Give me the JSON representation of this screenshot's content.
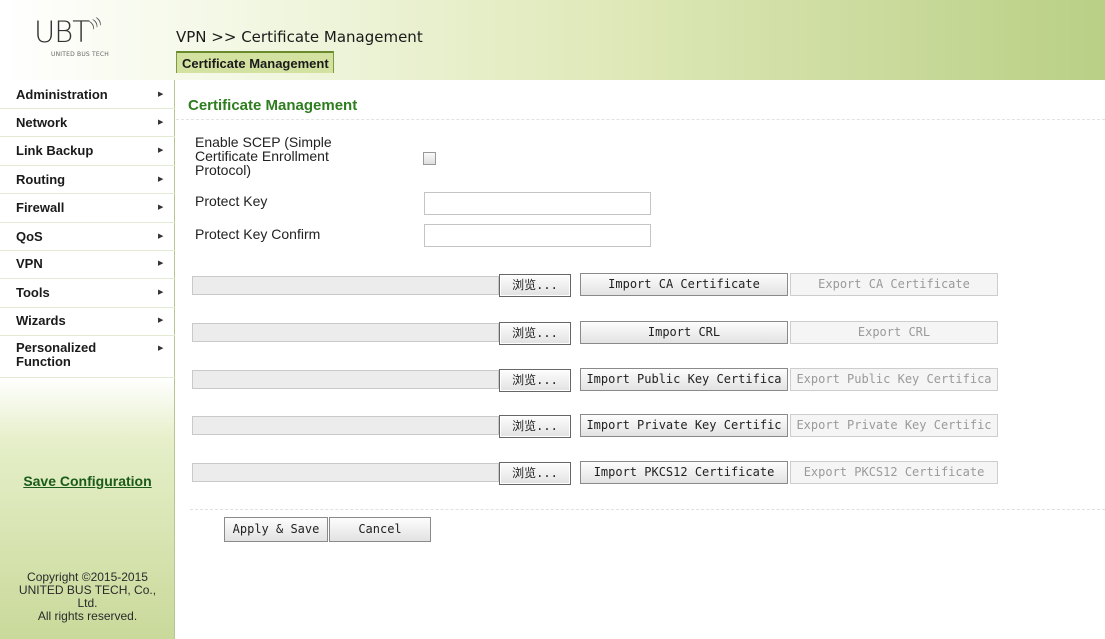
{
  "logo": {
    "mark": "UBT",
    "subtitle": "UNITED BUS TECH"
  },
  "header": {
    "breadcrumb": "VPN >> Certificate Management",
    "active_tab": "Certificate Management"
  },
  "sidebar": {
    "items": [
      {
        "label": "Administration",
        "arrow": "▶"
      },
      {
        "label": "Network",
        "arrow": "▶"
      },
      {
        "label": "Link Backup",
        "arrow": "▶"
      },
      {
        "label": "Routing",
        "arrow": "▶"
      },
      {
        "label": "Firewall",
        "arrow": "▶"
      },
      {
        "label": "QoS",
        "arrow": "▶"
      },
      {
        "label": "VPN",
        "arrow": "▶"
      },
      {
        "label": "Tools",
        "arrow": "▶"
      },
      {
        "label": "Wizards",
        "arrow": "▶"
      },
      {
        "label": "Personalized Function",
        "arrow": "▶"
      }
    ],
    "save_configuration": "Save Configuration",
    "copyright_lines": [
      "Copyright ©2015-2015",
      "UNITED BUS TECH, Co.,",
      "Ltd.",
      "All rights reserved."
    ]
  },
  "main": {
    "section_title": "Certificate Management",
    "scep_label_lines": [
      "Enable SCEP (Simple",
      "Certificate Enrollment",
      "Protocol)"
    ],
    "scep_enabled": false,
    "protect_key_label": "Protect Key",
    "protect_key_value": "",
    "protect_key_confirm_label": "Protect Key Confirm",
    "protect_key_confirm_value": "",
    "browse_label": "浏览...",
    "cert_rows": [
      {
        "import_label": "Import CA Certificate",
        "export_label": "Export CA Certificate"
      },
      {
        "import_label": "Import CRL",
        "export_label": "Export CRL"
      },
      {
        "import_label": "Import Public Key Certifica",
        "export_label": "Export Public Key Certifica"
      },
      {
        "import_label": "Import Private Key Certific",
        "export_label": "Export Private Key Certific"
      },
      {
        "import_label": "Import PKCS12 Certificate",
        "export_label": "Export PKCS12 Certificate"
      }
    ],
    "apply_label": "Apply & Save",
    "cancel_label": "Cancel"
  }
}
